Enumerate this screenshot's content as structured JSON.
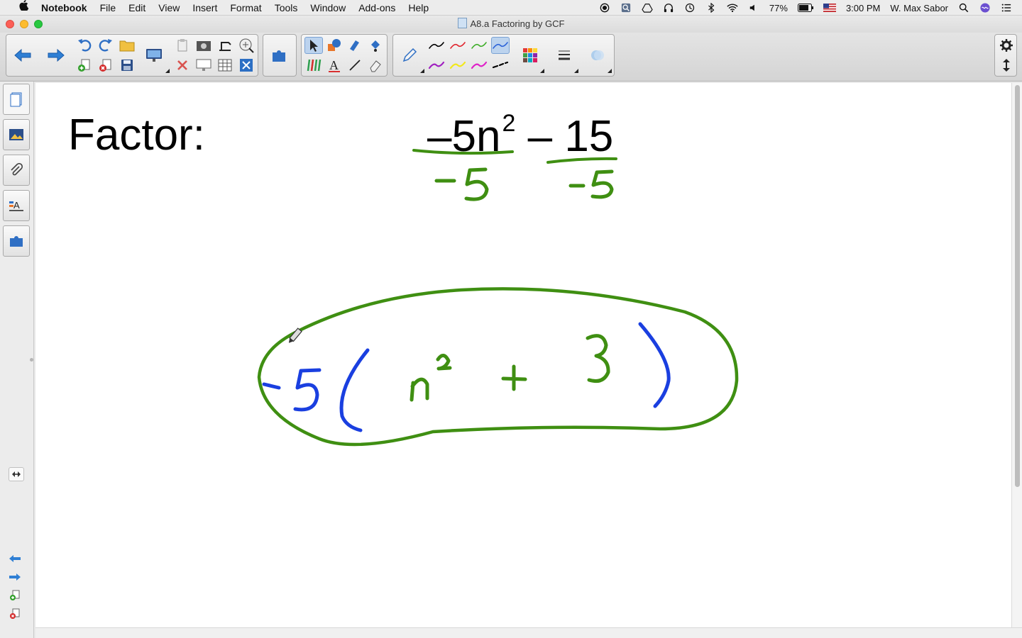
{
  "menubar": {
    "apple": "",
    "app": "Notebook",
    "items": [
      "File",
      "Edit",
      "View",
      "Insert",
      "Format",
      "Tools",
      "Window",
      "Add-ons",
      "Help"
    ],
    "battery": "77%",
    "time": "3:00 PM",
    "user": "W. Max Sabor"
  },
  "window": {
    "title": "A8.a Factoring by GCF"
  },
  "page": {
    "prompt": "Factor:",
    "expression": {
      "term1": "–5n",
      "exp1": "2",
      "op": " – ",
      "term2": "15"
    },
    "handwriting": {
      "div1": "-5",
      "div2": "-5",
      "answer": "-5( n² + 3 )"
    },
    "colors": {
      "green_ink": "#3f8f12",
      "blue_ink": "#1a3fe0"
    }
  },
  "toolbar": {
    "back": "back",
    "forward": "forward",
    "pen_colors": [
      "#000000",
      "#e0242e",
      "#3fae2a",
      "#2c63d8",
      "#a020c0",
      "#f2e81a",
      "#e020c8",
      "#000000"
    ]
  }
}
